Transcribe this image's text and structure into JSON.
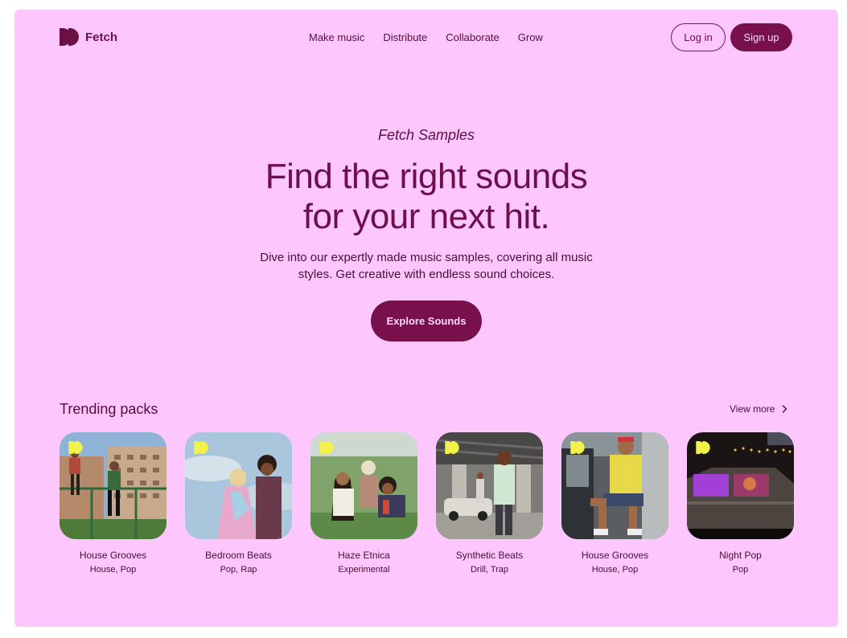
{
  "brand": {
    "name": "Fetch",
    "color": "#6b0f45",
    "accent": "#78114b",
    "background": "#fdc7fe"
  },
  "nav": {
    "links": [
      "Make music",
      "Distribute",
      "Collaborate",
      "Grow"
    ],
    "login_label": "Log in",
    "signup_label": "Sign up"
  },
  "hero": {
    "eyebrow": "Fetch Samples",
    "headline_line1": "Find the right sounds",
    "headline_line2": "for your next hit.",
    "subtext": "Dive into our expertly made music samples, covering all music styles. Get creative with endless sound choices.",
    "cta_label": "Explore Sounds"
  },
  "trending": {
    "title": "Trending packs",
    "view_more_label": "View more",
    "packs": [
      {
        "name": "House Grooves",
        "tags": "House, Pop",
        "icon": "fetch-logo-icon"
      },
      {
        "name": "Bedroom Beats",
        "tags": "Pop, Rap",
        "icon": "fetch-logo-icon"
      },
      {
        "name": "Haze Etnica",
        "tags": "Experimental",
        "icon": "fetch-logo-icon"
      },
      {
        "name": "Synthetic Beats",
        "tags": "Drill, Trap",
        "icon": "fetch-logo-icon"
      },
      {
        "name": "House Grooves",
        "tags": "House, Pop",
        "icon": "fetch-logo-icon"
      },
      {
        "name": "Night Pop",
        "tags": "Pop",
        "icon": "fetch-logo-icon"
      }
    ]
  }
}
